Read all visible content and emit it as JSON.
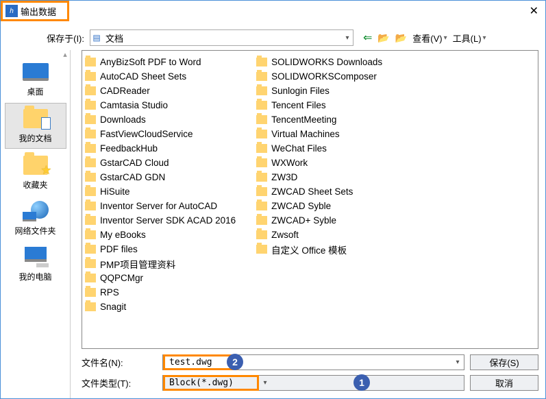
{
  "window": {
    "title": "输出数据",
    "close_icon": "✕"
  },
  "toolbar": {
    "save_in_label": "保存于(I):",
    "save_in_value": "文档",
    "view_label": "查看(V)",
    "tools_label": "工具(L)"
  },
  "places": {
    "scroll_up": "▴",
    "desktop": "桌面",
    "mydocs": "我的文档",
    "favorites": "收藏夹",
    "network": "网络文件夹",
    "mycomputer": "我的电脑"
  },
  "files": {
    "col1": [
      "AnyBizSoft PDF to Word",
      "AutoCAD Sheet Sets",
      "CADReader",
      "Camtasia Studio",
      "Downloads",
      "FastViewCloudService",
      "FeedbackHub",
      "GstarCAD Cloud",
      "GstarCAD GDN",
      "HiSuite",
      "Inventor Server for AutoCAD",
      "Inventor Server SDK ACAD 2016",
      "My eBooks",
      "PDF files",
      "PMP项目管理资料",
      "QQPCMgr",
      "RPS",
      "Snagit"
    ],
    "col2": [
      "SOLIDWORKS Downloads",
      "SOLIDWORKSComposer",
      "Sunlogin Files",
      "Tencent Files",
      "TencentMeeting",
      "Virtual Machines",
      "WeChat Files",
      "WXWork",
      "ZW3D",
      "ZWCAD Sheet Sets",
      "ZWCAD Syble",
      "ZWCAD+ Syble",
      "Zwsoft",
      "自定义 Office 模板"
    ]
  },
  "fields": {
    "filename_label": "文件名(N):",
    "filename_value": "test.dwg",
    "filetype_label": "文件类型(T):",
    "filetype_value": "Block(*.dwg)"
  },
  "buttons": {
    "save": "保存(S)",
    "cancel": "取消"
  },
  "annotations": {
    "one": "1",
    "two": "2"
  }
}
